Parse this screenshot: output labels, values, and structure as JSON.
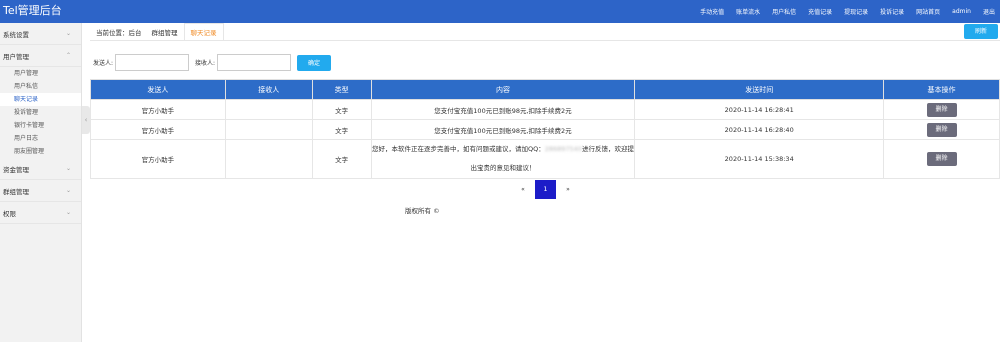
{
  "app": {
    "title": "Tel管理后台"
  },
  "topnav": [
    "手动充值",
    "账单流水",
    "用户私信",
    "充值记录",
    "提现记录",
    "投诉记录",
    "网站首页",
    "admin",
    "退出"
  ],
  "sidebar": {
    "groups": [
      {
        "label": "系统设置",
        "chevron": "⌄"
      },
      {
        "label": "用户管理",
        "chevron": "⌃",
        "items": [
          "用户管理",
          "用户私信",
          "聊天记录",
          "投诉管理",
          "银行卡管理",
          "用户日志",
          "朋友圈管理"
        ]
      },
      {
        "label": "资金管理",
        "chevron": "⌄"
      },
      {
        "label": "群组管理",
        "chevron": "⌄"
      },
      {
        "label": "权限",
        "chevron": "⌄"
      }
    ],
    "active_item": "聊天记录"
  },
  "breadcrumb": {
    "prefix": "当前位置：",
    "items": [
      "后台",
      "群组管理"
    ],
    "current": "聊天记录"
  },
  "refresh_label": "刷新",
  "filter": {
    "sender_label": "发送人:",
    "sender_value": "",
    "receiver_label": "接收人:",
    "receiver_value": "",
    "submit_label": "确定"
  },
  "table": {
    "headers": [
      "发送人",
      "接收人",
      "类型",
      "内容",
      "发送时间",
      "基本操作"
    ],
    "rows": [
      {
        "sender": "官方小助手",
        "receiver": "",
        "type": "文字",
        "content": "您支付宝充值100元已到账98元,扣除手续费2元",
        "time": "2020-11-14 16:28:41",
        "action": "删除"
      },
      {
        "sender": "官方小助手",
        "receiver": "",
        "type": "文字",
        "content": "您支付宝充值100元已到账98元,扣除手续费2元",
        "time": "2020-11-14 16:28:40",
        "action": "删除"
      },
      {
        "sender": "官方小助手",
        "receiver": "",
        "type": "文字",
        "content_before": "您好，本软件正在逐步完善中，如有问题或建议，请加QQ：",
        "content_blurred": "286897540",
        "content_after": "进行反馈，欢迎提出宝贵的意见和建议！",
        "time": "2020-11-14 15:38:34",
        "action": "删除"
      }
    ]
  },
  "pagination": {
    "prev": "«",
    "current": "1",
    "next": "»"
  },
  "footer": "版权所有 ©",
  "colors": {
    "topbar": "#2d64c8",
    "accent": "#22aaee",
    "active_tab": "#f08c28",
    "delete_button": "#6b6b7b",
    "page_active": "#1c1cc8"
  }
}
